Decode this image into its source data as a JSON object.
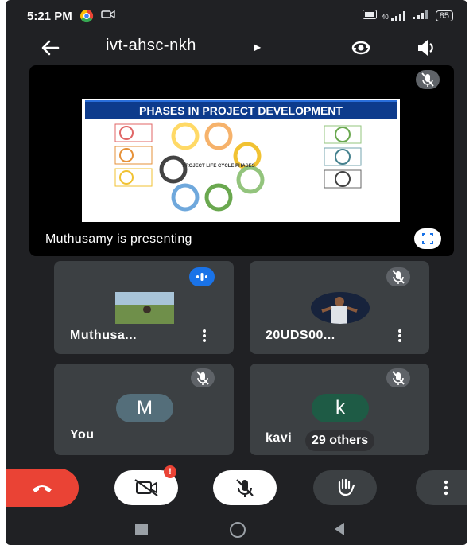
{
  "status_bar": {
    "time": "5:21 PM",
    "network": "40",
    "battery": "85"
  },
  "header": {
    "meeting_code": "ivt-ahsc-nkh"
  },
  "presentation": {
    "slide_title": "PHASES IN PROJECT DEVELOPMENT",
    "slide_center_label": "PROJECT LIFE CYCLE PHASES",
    "presenting_label": "Muthusamy is presenting"
  },
  "participants": [
    {
      "name": "Muthusa...",
      "avatar": "photo",
      "speaking": true
    },
    {
      "name": "20UDS00...",
      "avatar": "photo",
      "speaking": false
    },
    {
      "name": "You",
      "avatar_letter": "M",
      "muted": true
    },
    {
      "name": "kavi",
      "avatar_letter": "k",
      "muted": true,
      "others_badge": "29 others"
    }
  ],
  "colors": {
    "background": "#202124",
    "tile": "#3c4043",
    "end_call": "#ea4335",
    "speaking_badge": "#1a73e8",
    "avatar_m": "#546e7a",
    "avatar_k": "#1e5b45"
  },
  "icons": {
    "back": "arrow-left-icon",
    "switch_camera": "switch-camera-icon",
    "speaker": "speaker-icon",
    "end_call": "phone-hangup-icon",
    "camera_off": "camera-off-icon",
    "mic_off": "mic-off-icon",
    "raise_hand": "raise-hand-icon",
    "more": "more-vertical-icon"
  }
}
